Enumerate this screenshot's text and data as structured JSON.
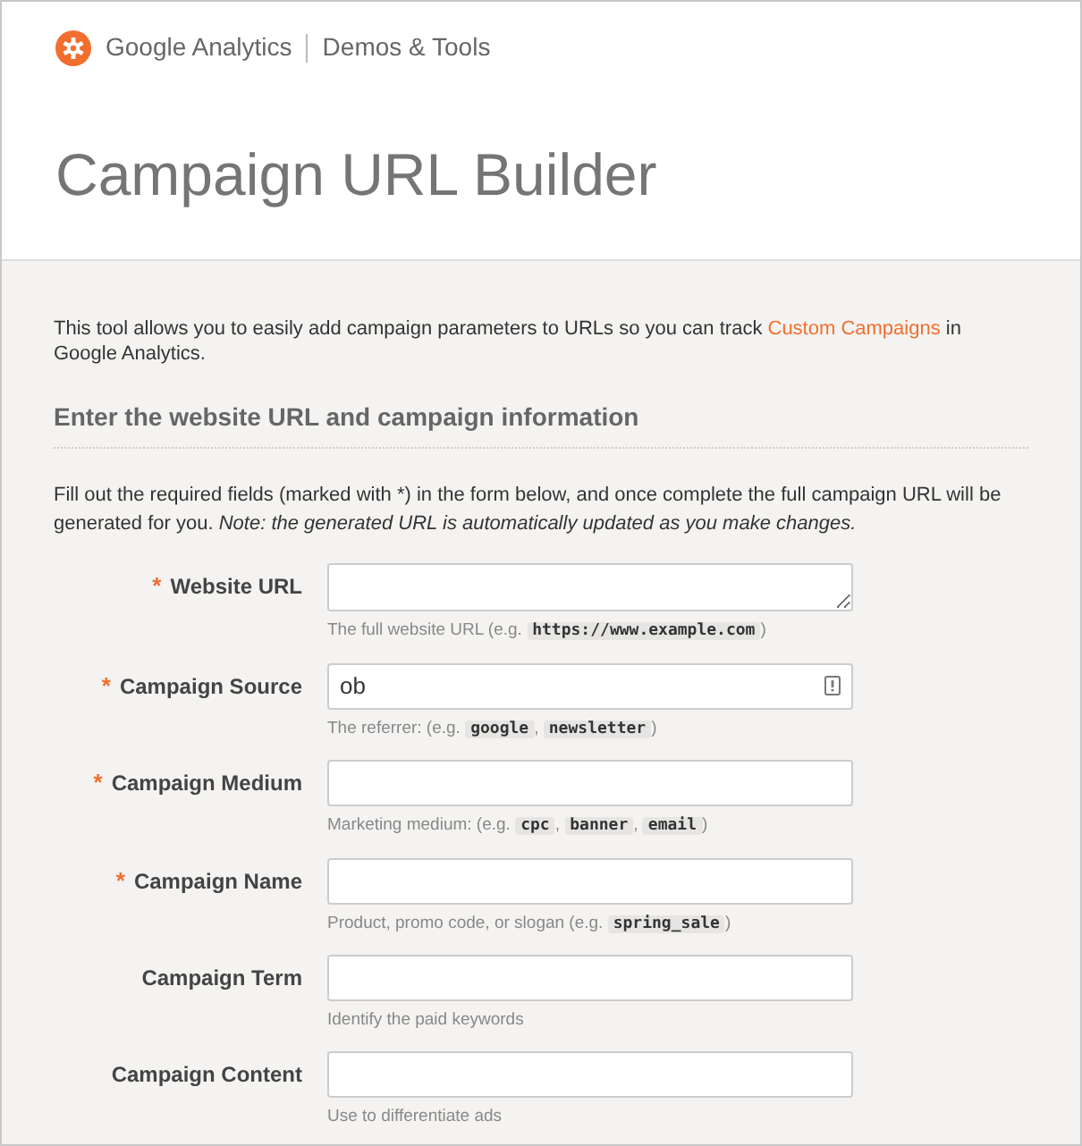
{
  "header": {
    "brand": "Google Analytics",
    "section": "Demos & Tools",
    "title": "Campaign URL Builder"
  },
  "intro": {
    "before": "This tool allows you to easily add campaign parameters to URLs so you can track ",
    "link": "Custom Campaigns",
    "after": " in Google Analytics."
  },
  "form_heading": "Enter the website URL and campaign information",
  "instructions": "Fill out the required fields (marked with *) in the form below, and once complete the full campaign URL will be generated for you. *Note: the generated URL is automatically updated as you make changes.*",
  "fields": [
    {
      "label": "Website URL",
      "required_mark": "*",
      "kind": "textarea",
      "autofill_icon": false,
      "help": [
        {
          "kind": "text",
          "text": "The full website URL (e.g. "
        },
        {
          "kind": "code",
          "text": "https://www.example.com"
        },
        {
          "kind": "text",
          "text": ")"
        }
      ]
    },
    {
      "label": "Campaign Source",
      "required_mark": "*",
      "kind": "input",
      "value": "ob",
      "autofill_icon": true,
      "help": [
        {
          "kind": "text",
          "text": "The referrer: (e.g. "
        },
        {
          "kind": "code",
          "text": "google"
        },
        {
          "kind": "text",
          "text": ", "
        },
        {
          "kind": "code",
          "text": "newsletter"
        },
        {
          "kind": "text",
          "text": ")"
        }
      ]
    },
    {
      "label": "Campaign Medium",
      "required_mark": "*",
      "kind": "input",
      "autofill_icon": false,
      "help": [
        {
          "kind": "text",
          "text": "Marketing medium: (e.g. "
        },
        {
          "kind": "code",
          "text": "cpc"
        },
        {
          "kind": "text",
          "text": ", "
        },
        {
          "kind": "code",
          "text": "banner"
        },
        {
          "kind": "text",
          "text": ", "
        },
        {
          "kind": "code",
          "text": "email"
        },
        {
          "kind": "text",
          "text": ")"
        }
      ]
    },
    {
      "label": "Campaign Name",
      "required_mark": "*",
      "kind": "input",
      "autofill_icon": false,
      "help": [
        {
          "kind": "text",
          "text": "Product, promo code, or slogan (e.g. "
        },
        {
          "kind": "code",
          "text": "spring_sale"
        },
        {
          "kind": "text",
          "text": ")"
        }
      ]
    },
    {
      "label": "Campaign Term",
      "kind": "input",
      "autofill_icon": false,
      "help": [
        {
          "kind": "text",
          "text": "Identify the paid keywords"
        }
      ]
    },
    {
      "label": "Campaign Content",
      "kind": "input",
      "autofill_icon": false,
      "help": [
        {
          "kind": "text",
          "text": "Use to differentiate ads"
        }
      ]
    }
  ]
}
